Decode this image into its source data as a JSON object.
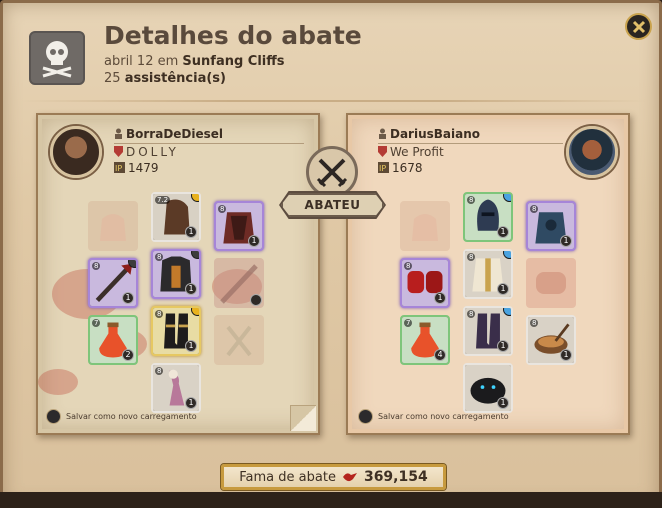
{
  "header": {
    "title": "Detalhes do abate",
    "date": "abril 12",
    "date_connector": "em",
    "location": "Sunfang Cliffs",
    "assists_count": "25",
    "assists_label": "assistência(s)"
  },
  "killer": {
    "name": "BorraDeDiesel",
    "guild": "DOLLY",
    "item_power": "1479",
    "loadout_label": "Salvar como novo carregamento"
  },
  "victim": {
    "name": "DariusBaiano",
    "guild": "We Profit",
    "item_power": "1678",
    "loadout_label": "Salvar como novo carregamento"
  },
  "center": {
    "ribbon_label": "ABATEU"
  },
  "footer": {
    "fame_label": "Fama de abate",
    "fame_value": "369,154"
  },
  "killer_items": [
    {
      "slot": "bag",
      "empty": true
    },
    {
      "slot": "head",
      "quality": "white",
      "tier": "7.2",
      "qty": "1",
      "icon": "cowl-icon"
    },
    {
      "slot": "cape",
      "quality": "purple",
      "tier": "8",
      "qty": "1",
      "icon": "cape-icon"
    },
    {
      "slot": "mainhand",
      "quality": "purple",
      "tier": "8",
      "qty": "1",
      "icon": "spear-icon"
    },
    {
      "slot": "armor",
      "quality": "purple",
      "tier": "8",
      "qty": "1",
      "icon": "armor-icon"
    },
    {
      "slot": "offhand",
      "empty": true,
      "icon": "offhand-icon"
    },
    {
      "slot": "potion",
      "quality": "green",
      "tier": "7",
      "qty": "2",
      "icon": "potion-icon"
    },
    {
      "slot": "shoes",
      "quality": "gold",
      "tier": "8",
      "qty": "1",
      "icon": "boots-icon"
    },
    {
      "slot": "food",
      "empty": true,
      "icon": "food-icon"
    },
    {
      "slot": "mount",
      "quality": "white",
      "tier": "8",
      "qty": "1",
      "icon": "mount-icon"
    }
  ],
  "victim_items": [
    {
      "slot": "bag",
      "empty": true
    },
    {
      "slot": "head",
      "quality": "green",
      "tier": "8",
      "qty": "1",
      "icon": "helmet-icon"
    },
    {
      "slot": "cape",
      "quality": "purple",
      "tier": "8",
      "qty": "1",
      "icon": "cape-icon"
    },
    {
      "slot": "mainhand",
      "quality": "purple",
      "tier": "8",
      "qty": "1",
      "icon": "gauntlets-icon"
    },
    {
      "slot": "armor",
      "quality": "white",
      "tier": "8",
      "qty": "1",
      "icon": "robe-icon"
    },
    {
      "slot": "offhand",
      "empty": true,
      "icon": "offhand-icon"
    },
    {
      "slot": "potion",
      "quality": "green",
      "tier": "7",
      "qty": "4",
      "icon": "potion-icon"
    },
    {
      "slot": "shoes",
      "quality": "white",
      "tier": "8",
      "qty": "1",
      "icon": "boots-icon"
    },
    {
      "slot": "food",
      "quality": "white",
      "tier": "8",
      "qty": "1",
      "icon": "stew-icon"
    },
    {
      "slot": "mount",
      "quality": "white",
      "tier": "8",
      "qty": "1",
      "icon": "panther-icon"
    }
  ]
}
